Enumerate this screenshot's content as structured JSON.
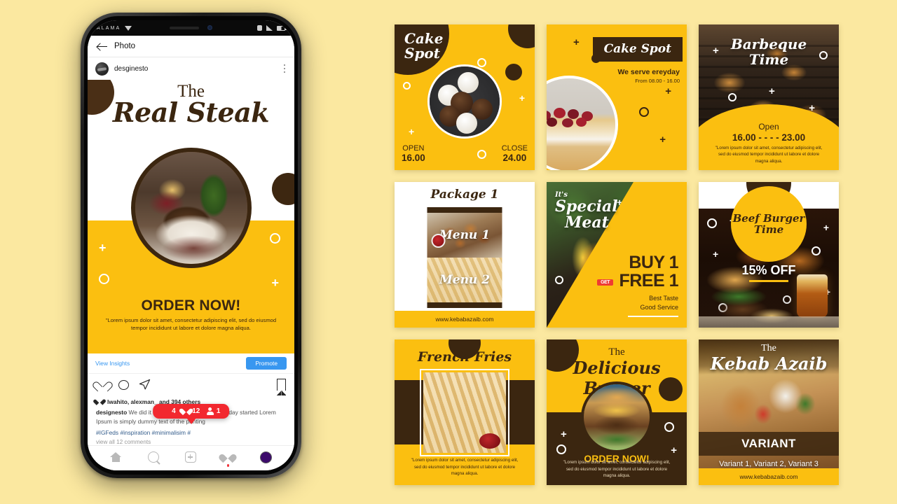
{
  "background_color": "#fbe8a0",
  "accent_yellow": "#fbbf10",
  "accent_brown": "#3b2610",
  "phone": {
    "status_bar": {
      "carrier": "ALAMA",
      "wifi_icon": "wifi-icon",
      "sim_icon": "sim-icon",
      "signal_icon": "signal-icon",
      "battery_icon": "battery-icon"
    },
    "topbar": {
      "back_icon": "back-arrow-icon",
      "title": "Photo"
    },
    "post_header": {
      "avatar": "user-avatar",
      "username": "desginesto",
      "menu_icon": "more-options-icon"
    },
    "poster": {
      "the": "The",
      "title": "Real Steak",
      "cta": "ORDER NOW!",
      "lorem": "\"Lorem ipsum dolor sit amet, consectetur adipiscing elit, sed do eiusmod tempor incididunt ut labore et dolore magna aliqua."
    },
    "insights": {
      "link": "View Insights",
      "promote_label": "Promote"
    },
    "actions": {
      "like_icon": "heart-icon",
      "comment_icon": "comment-icon",
      "share_icon": "share-icon",
      "save_icon": "bookmark-icon"
    },
    "caption": {
      "likes": "lwahito, alexman_ and 394 others",
      "username": "designesto",
      "text": "We did it again,  something to get your day started Lorem Ipsum is simply dummy text of the printing",
      "hashtags": "#IGFeds #inspiration #minimalisim #",
      "view_comments": "view all 12 comments"
    },
    "badge": {
      "comments": "4",
      "likes": "12",
      "follows": "1"
    },
    "tabbar": {
      "home_icon": "home-icon",
      "search_icon": "search-icon",
      "add_icon": "add-post-icon",
      "activity_icon": "heart-icon",
      "profile_icon": "profile-avatar-icon"
    }
  },
  "grid": [
    {
      "id": "cake-spot-open-close",
      "title": "Cake\nSpot",
      "title_line1": "Cake",
      "title_line2": "Spot",
      "open_label": "OPEN",
      "open_value": "16.00",
      "close_label": "CLOSE",
      "close_value": "24.00"
    },
    {
      "id": "cake-spot-serve",
      "brand": "Cake Spot",
      "headline": "We serve ereyday",
      "subline": "From 08.00 - 16.00"
    },
    {
      "id": "barbeque-time",
      "title_line1": "Barbeque",
      "title_line2": "Time",
      "open_label": "Open",
      "hours": "16.00 - - - - 23.00",
      "lorem": "\"Lorem ipsum dolor sit amet, consectetur adipiscing elit, sed do eiusmod tempor incididunt ut labore et dolore magna aliqua."
    },
    {
      "id": "package-1",
      "title": "Package 1",
      "menu1": "Menu 1",
      "menu2": "Menu 2",
      "url": "www.kebabazaib.com"
    },
    {
      "id": "special-meat",
      "its": "It's",
      "title_line1": "Special",
      "title_line2": "Meat",
      "buy_line1": "BUY 1",
      "get_badge": "GET",
      "buy_line2": "FREE 1",
      "tagline1": "Best Taste",
      "tagline2": "Good Service"
    },
    {
      "id": "beef-burger-time",
      "title_line1": "Beef Burger",
      "title_line2": "Time",
      "discount": "15% OFF"
    },
    {
      "id": "french-fries",
      "title": "French Fries",
      "lorem": "\"Lorem ipsum dolor sit amet, consectetur adipiscing elit, sed do eiusmod tempor incididunt ut labore et dolore magna aliqua."
    },
    {
      "id": "delicious-burger",
      "the": "The",
      "title": "Delicious Burger",
      "cta": "ORDER NOW!",
      "lorem": "\"Lorem ipsum dolor sit amet, consectetur adipiscing elit, sed do eiusmod tempor incididunt ut labore et dolore magna aliqua."
    },
    {
      "id": "kebab-azaib",
      "the": "The",
      "title": "Kebab Azaib",
      "variant_label": "VARIANT",
      "variants": "Variant 1, Variant 2, Variant 3",
      "url": "www.kebabazaib.com"
    }
  ]
}
